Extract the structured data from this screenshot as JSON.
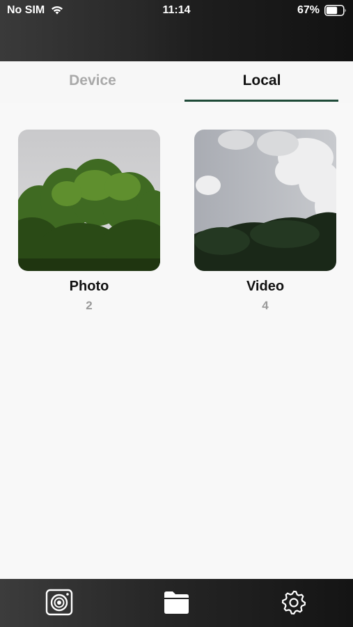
{
  "status_bar": {
    "carrier": "No SIM",
    "time": "11:14",
    "battery": "67%",
    "battery_level": 0.67
  },
  "tabs": [
    {
      "label": "Device",
      "active": false
    },
    {
      "label": "Local",
      "active": true
    }
  ],
  "accent_color": "#1f4a38",
  "albums": [
    {
      "name": "Photo",
      "count": "2",
      "thumbnail": "trees-photo"
    },
    {
      "name": "Video",
      "count": "4",
      "thumbnail": "clouds-forest-photo"
    }
  ],
  "bottom_nav": [
    {
      "icon": "camera-icon"
    },
    {
      "icon": "folder-icon",
      "active": true
    },
    {
      "icon": "gear-icon"
    }
  ]
}
